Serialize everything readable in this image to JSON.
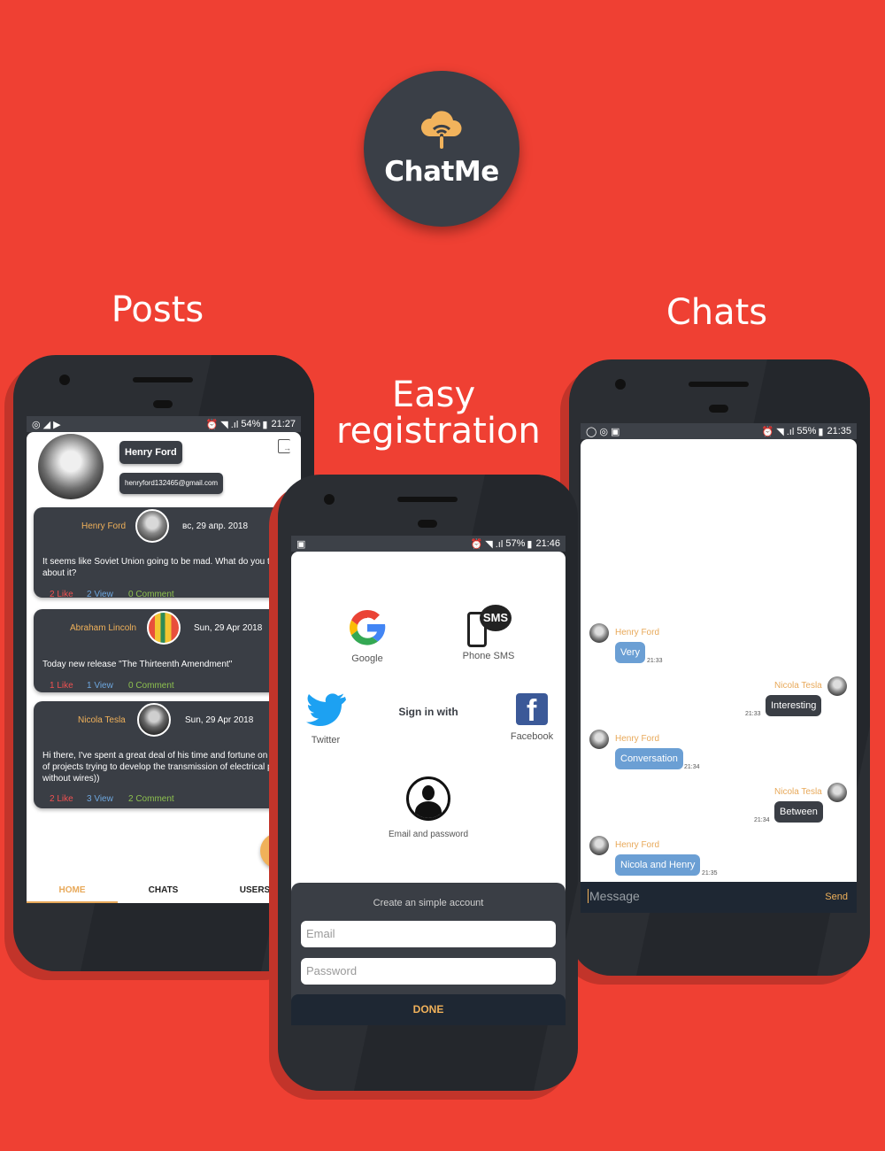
{
  "logo": {
    "text": "ChatMe"
  },
  "headings": {
    "posts": "Posts",
    "chats": "Chats",
    "registration_line1": "Easy",
    "registration_line2": "registration"
  },
  "posts_phone": {
    "status_battery": "54%",
    "status_time": "21:27",
    "profile": {
      "name": "Henry Ford",
      "email": "henryford132465@gmail.com"
    },
    "posts": [
      {
        "author": "Henry Ford",
        "date": "вс, 29 апр. 2018",
        "text": "It seems like Soviet Union going to be mad. What do you think about it?",
        "likes": "2 Like",
        "views": "2 View",
        "comments": "0 Comment"
      },
      {
        "author": "Abraham Lincoln",
        "date": "Sun, 29 Apr 2018",
        "text": "Today new release \"The Thirteenth Amendment\"",
        "likes": "1 Like",
        "views": "1 View",
        "comments": "0 Comment"
      },
      {
        "author": "Nicola Tesla",
        "date": "Sun, 29 Apr 2018",
        "text": "Hi there, I've spent a great deal of his time and fortune on a series of projects trying to develop the transmission of electrical power without wires))",
        "likes": "2 Like",
        "views": "3 View",
        "comments": "2 Comment"
      }
    ],
    "tabs": {
      "home": "HOME",
      "chats": "CHATS",
      "users": "USERS"
    }
  },
  "registration_phone": {
    "status_battery": "57%",
    "status_time": "21:46",
    "providers": {
      "google": "Google",
      "sms": "Phone SMS",
      "sms_badge": "SMS",
      "twitter": "Twitter",
      "facebook": "Facebook",
      "email": "Email and password"
    },
    "sign_in_with": "Sign in with",
    "form": {
      "title": "Create an simple account",
      "email_placeholder": "Email",
      "password_placeholder": "Password",
      "done": "DONE"
    }
  },
  "chats_phone": {
    "status_battery": "55%",
    "status_time": "21:35",
    "messages": [
      {
        "name": "Henry Ford",
        "text": "Very",
        "time": "21:33"
      },
      {
        "name": "Nicola Tesla",
        "text": "Interesting",
        "time": "21:33"
      },
      {
        "name": "Henry Ford",
        "text": "Conversation",
        "time": "21:34"
      },
      {
        "name": "Nicola Tesla",
        "text": "Between",
        "time": "21:34"
      },
      {
        "name": "Henry Ford",
        "text": "Nicola and Henry",
        "time": "21:35"
      }
    ],
    "input_placeholder": "Message",
    "send": "Send"
  },
  "colors": {
    "background": "#ef4033",
    "dark": "#3a3e45",
    "accent": "#f0b15a",
    "bubble_in": "#6b9fd4"
  }
}
